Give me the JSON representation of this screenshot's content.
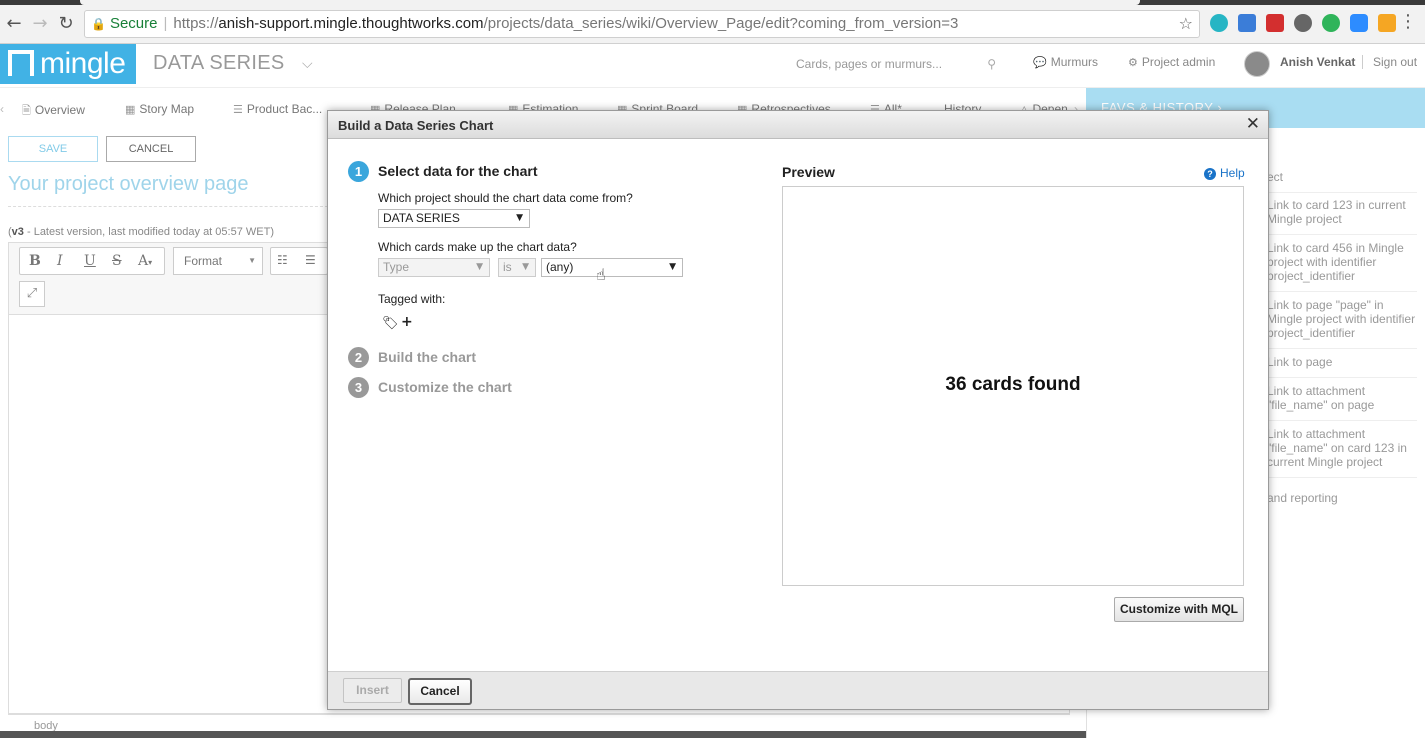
{
  "browser": {
    "secure_label": "Secure",
    "url_scheme": "https://",
    "url_host": "anish-support.mingle.thoughtworks.com",
    "url_path": "/projects/data_series/wiki/Overview_Page/edit?coming_from_version=3",
    "back_icon": "←",
    "forward_icon": "→",
    "reload_icon": "↻",
    "star_icon": "☆",
    "menu_icon": "⋮"
  },
  "header": {
    "logo_text": "mingle",
    "project_name": "DATA SERIES",
    "search_placeholder": "Cards, pages or murmurs...",
    "murmurs_label": "Murmurs",
    "project_admin_label": "Project admin",
    "user_name": "Anish Venkat",
    "sign_out_label": "Sign out",
    "brand_color": "#41b2e5"
  },
  "nav": {
    "tabs": [
      {
        "label": "Overview"
      },
      {
        "label": "Story Map"
      },
      {
        "label": "Product Bac..."
      },
      {
        "label": "Release Plan"
      },
      {
        "label": "Estimation"
      },
      {
        "label": "Sprint Board"
      },
      {
        "label": "Retrospectives"
      },
      {
        "label": "All*"
      },
      {
        "label": "History"
      },
      {
        "label": "Depen"
      }
    ],
    "favs_label": "FAVS & HISTORY"
  },
  "editor": {
    "save_label": "SAVE",
    "cancel_label": "CANCEL",
    "page_title": "Your project overview page",
    "version_tag": "v3",
    "version_text": " - Latest version, last modified today at 05:57 WET)",
    "format_label": "Format",
    "status_path": "body"
  },
  "side_panel": {
    "items": [
      {
        "label": "ect"
      },
      {
        "label": "Link to card 123 in current Mingle project"
      },
      {
        "label": "Link to card 456 in Mingle project with identifier project_identifier"
      },
      {
        "label": "Link to page \"page\" in Mingle project with identifier project_identifier"
      },
      {
        "label": "Link to page"
      },
      {
        "label": "Link to attachment \"file_name\" on page"
      },
      {
        "label": "Link to attachment \"file_name\" on card 123 in current Mingle project"
      },
      {
        "label": "and reporting"
      }
    ]
  },
  "modal": {
    "title": "Build a Data Series Chart",
    "close_icon": "✕",
    "steps": [
      {
        "num": "1",
        "label": "Select data for the chart"
      },
      {
        "num": "2",
        "label": "Build the chart"
      },
      {
        "num": "3",
        "label": "Customize the chart"
      }
    ],
    "project_question": "Which project should the chart data come from?",
    "project_value": "DATA SERIES",
    "cards_question": "Which cards make up the chart data?",
    "filter": {
      "property": "Type",
      "operator": "is",
      "value": "(any)"
    },
    "tagged_with_label": "Tagged with:",
    "preview_label": "Preview",
    "help_label": "Help",
    "preview_result": "36 cards found",
    "mql_button": "Customize with MQL",
    "insert_label": "Insert",
    "cancel_label": "Cancel",
    "active_step_color": "#3aa6dc",
    "inactive_step_color": "#999999"
  }
}
